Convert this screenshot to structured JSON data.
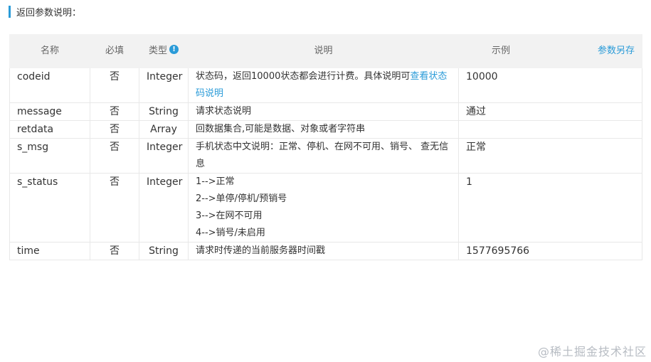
{
  "section": {
    "title": "返回参数说明："
  },
  "table": {
    "headers": {
      "name": "名称",
      "required": "必填",
      "type": "类型",
      "description": "说明",
      "example": "示例",
      "save_as": "参数另存"
    },
    "rows": [
      {
        "name": "codeid",
        "required": "否",
        "type": "Integer",
        "desc_text": "状态码，返回10000状态都会进行计费。具体说明可",
        "desc_link": "查看状态码说明",
        "example": "10000"
      },
      {
        "name": "message",
        "required": "否",
        "type": "String",
        "desc_text": "请求状态说明",
        "example": "通过"
      },
      {
        "name": "retdata",
        "required": "否",
        "type": "Array",
        "desc_text": "回数据集合,可能是数据、对象或者字符串",
        "example": ""
      },
      {
        "name": "s_msg",
        "required": "否",
        "type": "Integer",
        "desc_text": "手机状态中文说明：正常、停机、在网不可用、销号、 查无信息",
        "example": "正常"
      },
      {
        "name": "s_status",
        "required": "否",
        "type": "Integer",
        "desc_lines": [
          "1-->正常",
          "2-->单停/停机/预销号",
          "3-->在网不可用",
          "4-->销号/未启用"
        ],
        "example": "1"
      },
      {
        "name": "time",
        "required": "否",
        "type": "String",
        "desc_text": "请求时传递的当前服务器时间戳",
        "example": "1577695766"
      }
    ]
  },
  "watermark": "@稀土掘金技术社区",
  "colors": {
    "accent": "#2a9bd8",
    "header_bg": "#f2f2f2",
    "border": "#e8e8e8"
  },
  "icons": {
    "type_info": "info-icon"
  }
}
